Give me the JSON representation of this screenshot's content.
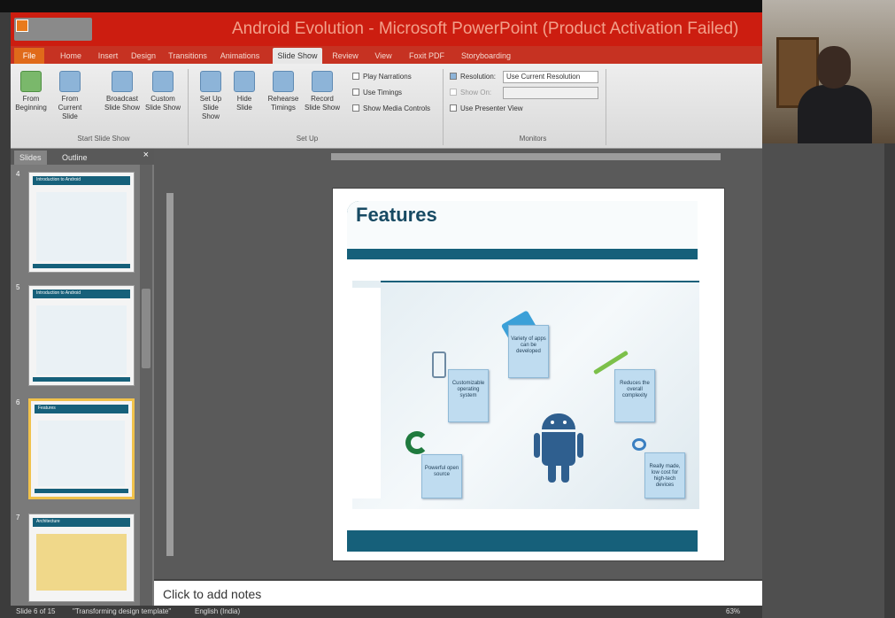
{
  "window": {
    "title": "Android Evolution - Microsoft PowerPoint (Product Activation Failed)"
  },
  "tabs": [
    "File",
    "Home",
    "Insert",
    "Design",
    "Transitions",
    "Animations",
    "Slide Show",
    "Review",
    "View",
    "Foxit PDF",
    "Storyboarding"
  ],
  "ribbon": {
    "start": {
      "from_beginning": "From Beginning",
      "from_current": "From Current Slide",
      "broadcast": "Broadcast Slide Show",
      "custom": "Custom Slide Show",
      "label": "Start Slide Show"
    },
    "setup": {
      "setup_show": "Set Up Slide Show",
      "hide_slide": "Hide Slide",
      "rehearse": "Rehearse Timings",
      "record": "Record Slide Show",
      "play_narrations": "Play Narrations",
      "use_timings": "Use Timings",
      "show_media": "Show Media Controls",
      "label": "Set Up"
    },
    "monitors": {
      "resolution_label": "Resolution:",
      "resolution_value": "Use Current Resolution",
      "show_on": "Show On:",
      "presenter_view": "Use Presenter View",
      "label": "Monitors"
    }
  },
  "pane": {
    "tabs": [
      "Slides",
      "Outline"
    ],
    "close": "×",
    "thumbs": [
      {
        "num": "4",
        "title": "Introduction to Android"
      },
      {
        "num": "5",
        "title": "Introduction to Android"
      },
      {
        "num": "6",
        "title": "Features"
      },
      {
        "num": "7",
        "title": "Architecture"
      }
    ]
  },
  "slide": {
    "title": "Features",
    "features": [
      "Variety of apps can be developed",
      "Customizable operating system",
      "Reduces the overall complexity",
      "Powerful open source",
      "Really made, low cost for high-tech devices"
    ]
  },
  "notes_placeholder": "Click to add notes",
  "status": {
    "slide_info": "Slide 6 of 15",
    "theme": "\"Transforming design template\"",
    "language": "English (India)",
    "zoom": "63%"
  },
  "colors": {
    "title_bar": "#cc1d10",
    "slide_accent": "#16607a",
    "selected_thumb": "#f1c24b"
  }
}
